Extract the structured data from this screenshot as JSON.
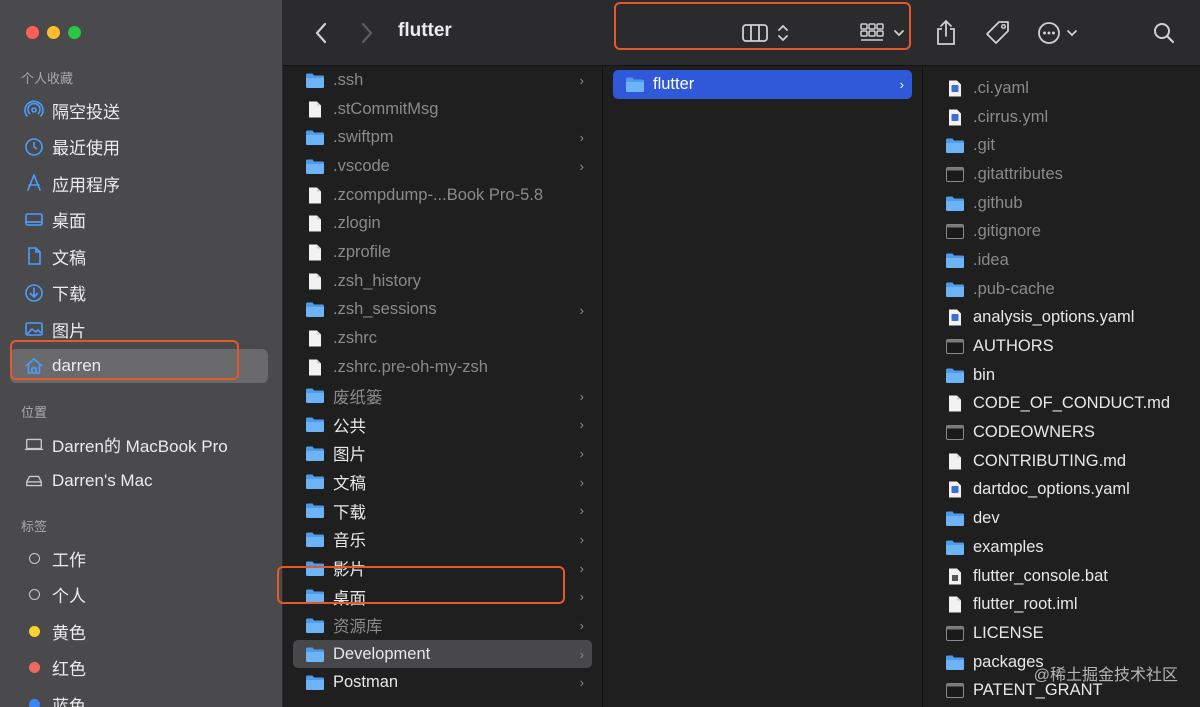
{
  "window": {
    "title": "flutter"
  },
  "sidebar": {
    "favorites_heading": "个人收藏",
    "favorites": [
      {
        "label": "隔空投送",
        "icon": "airdrop-icon"
      },
      {
        "label": "最近使用",
        "icon": "clock-icon"
      },
      {
        "label": "应用程序",
        "icon": "applications-icon"
      },
      {
        "label": "桌面",
        "icon": "desktop-icon"
      },
      {
        "label": "文稿",
        "icon": "document-icon"
      },
      {
        "label": "下载",
        "icon": "download-icon"
      },
      {
        "label": "图片",
        "icon": "photo-icon"
      },
      {
        "label": "darren",
        "icon": "home-icon",
        "selected": true
      }
    ],
    "locations_heading": "位置",
    "locations": [
      {
        "label": "Darren的 MacBook Pro",
        "icon": "laptop-icon"
      },
      {
        "label": "Darren's Mac",
        "icon": "drive-icon"
      }
    ],
    "tags_heading": "标签",
    "tags": [
      {
        "label": "工作",
        "color": "hollow"
      },
      {
        "label": "个人",
        "color": "hollow"
      },
      {
        "label": "黄色",
        "color": "#f5d430"
      },
      {
        "label": "红色",
        "color": "#ee6a5e"
      },
      {
        "label": "蓝色",
        "color": "#3b86f7"
      }
    ]
  },
  "toolbar": {
    "back_icon": "chevron-left-icon",
    "forward_icon": "chevron-right-icon",
    "view_icon": "columns-view-icon",
    "group_icon": "grid-group-icon",
    "share_icon": "share-icon",
    "tag_icon": "tag-icon",
    "more_icon": "ellipsis-icon",
    "search_icon": "search-icon"
  },
  "column1": [
    {
      "name": ".ssh",
      "type": "folder",
      "dim": true,
      "chevron": true
    },
    {
      "name": ".stCommitMsg",
      "type": "file",
      "dim": true
    },
    {
      "name": ".swiftpm",
      "type": "folder",
      "dim": true,
      "chevron": true
    },
    {
      "name": ".vscode",
      "type": "folder",
      "dim": true,
      "chevron": true
    },
    {
      "name": ".zcompdump-...Book Pro-5.8",
      "type": "file",
      "dim": true
    },
    {
      "name": ".zlogin",
      "type": "file",
      "dim": true
    },
    {
      "name": ".zprofile",
      "type": "file",
      "dim": true
    },
    {
      "name": ".zsh_history",
      "type": "file",
      "dim": true
    },
    {
      "name": ".zsh_sessions",
      "type": "folder",
      "dim": true,
      "chevron": true
    },
    {
      "name": ".zshrc",
      "type": "file",
      "dim": true
    },
    {
      "name": ".zshrc.pre-oh-my-zsh",
      "type": "file",
      "dim": true
    },
    {
      "name": "废纸篓",
      "type": "folder",
      "dim": true,
      "chevron": true
    },
    {
      "name": "公共",
      "type": "folder",
      "chevron": true
    },
    {
      "name": "图片",
      "type": "folder",
      "chevron": true
    },
    {
      "name": "文稿",
      "type": "folder",
      "chevron": true
    },
    {
      "name": "下载",
      "type": "folder",
      "chevron": true
    },
    {
      "name": "音乐",
      "type": "folder",
      "chevron": true
    },
    {
      "name": "影片",
      "type": "folder",
      "chevron": true
    },
    {
      "name": "桌面",
      "type": "folder",
      "chevron": true
    },
    {
      "name": "资源库",
      "type": "folder",
      "dim": true,
      "chevron": true
    },
    {
      "name": "Development",
      "type": "folder",
      "chevron": true,
      "focus": true
    },
    {
      "name": "Postman",
      "type": "folder",
      "chevron": true
    }
  ],
  "column2": [
    {
      "name": "flutter",
      "type": "folder",
      "chevron": true,
      "selected": true
    }
  ],
  "column3": [
    {
      "name": ".ci.yaml",
      "type": "yaml",
      "dim": true
    },
    {
      "name": ".cirrus.yml",
      "type": "yaml",
      "dim": true
    },
    {
      "name": ".git",
      "type": "folder",
      "dim": true
    },
    {
      "name": ".gitattributes",
      "type": "exec",
      "dim": true
    },
    {
      "name": ".github",
      "type": "folder",
      "dim": true
    },
    {
      "name": ".gitignore",
      "type": "exec",
      "dim": true
    },
    {
      "name": ".idea",
      "type": "folder",
      "dim": true
    },
    {
      "name": ".pub-cache",
      "type": "folder",
      "dim": true
    },
    {
      "name": "analysis_options.yaml",
      "type": "yaml"
    },
    {
      "name": "AUTHORS",
      "type": "exec"
    },
    {
      "name": "bin",
      "type": "folder"
    },
    {
      "name": "CODE_OF_CONDUCT.md",
      "type": "file"
    },
    {
      "name": "CODEOWNERS",
      "type": "exec"
    },
    {
      "name": "CONTRIBUTING.md",
      "type": "file"
    },
    {
      "name": "dartdoc_options.yaml",
      "type": "yaml"
    },
    {
      "name": "dev",
      "type": "folder"
    },
    {
      "name": "examples",
      "type": "folder"
    },
    {
      "name": "flutter_console.bat",
      "type": "bat"
    },
    {
      "name": "flutter_root.iml",
      "type": "file"
    },
    {
      "name": "LICENSE",
      "type": "exec"
    },
    {
      "name": "packages",
      "type": "folder"
    },
    {
      "name": "PATENT_GRANT",
      "type": "exec"
    }
  ],
  "watermark": "@稀土掘金技术社区"
}
